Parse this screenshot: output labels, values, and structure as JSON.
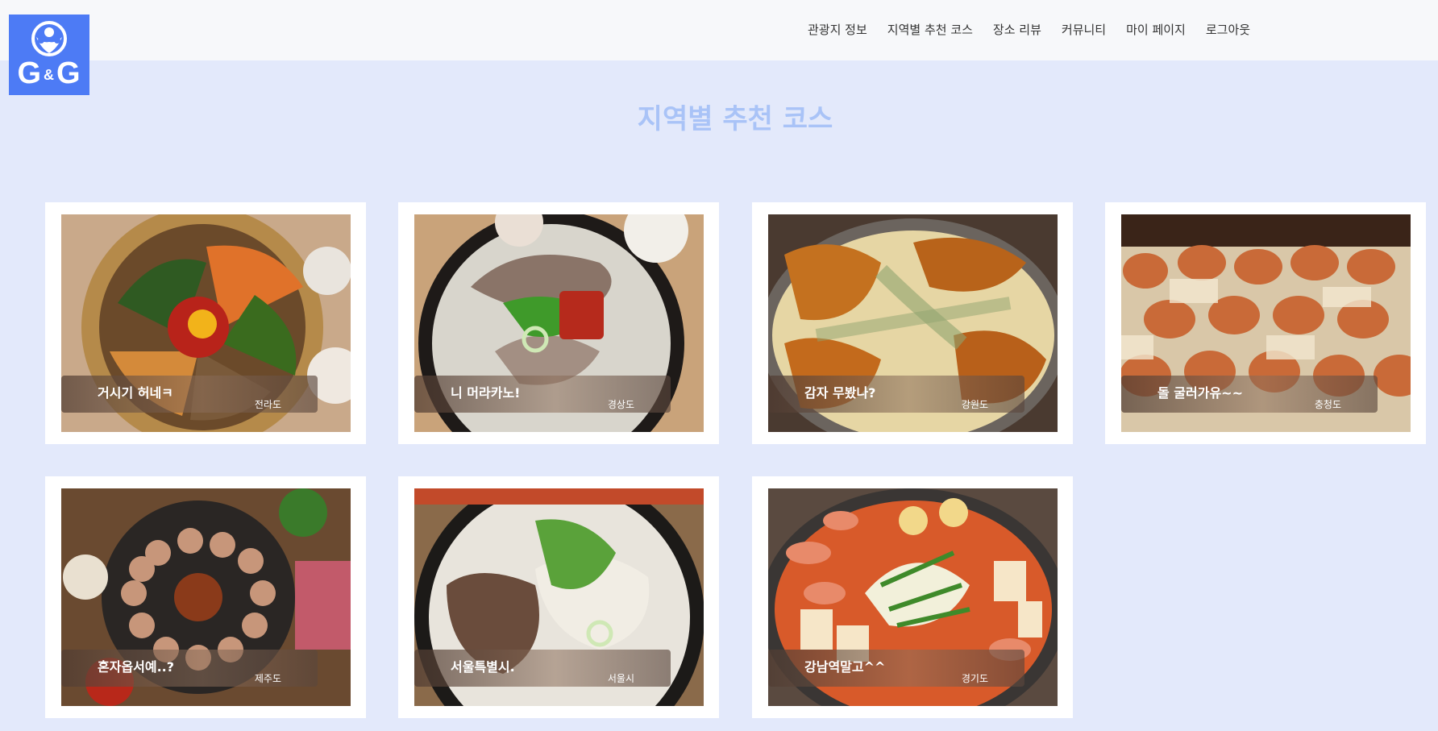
{
  "brand": {
    "logo_text_left": "G",
    "logo_text_amp": "&",
    "logo_text_right": "G"
  },
  "nav": [
    {
      "label": "관광지 정보"
    },
    {
      "label": "지역별 추천 코스"
    },
    {
      "label": "장소 리뷰"
    },
    {
      "label": "커뮤니티"
    },
    {
      "label": "마이 페이지"
    },
    {
      "label": "로그아웃"
    }
  ],
  "page": {
    "title": "지역별 추천 코스"
  },
  "cards": [
    {
      "title": "거시기 허네ㅋ",
      "region": "전라도",
      "image": "bibimbap"
    },
    {
      "title": "니 머라카노!",
      "region": "경상도",
      "image": "pork-soup"
    },
    {
      "title": "감자 무봤나?",
      "region": "강원도",
      "image": "dakgalbi"
    },
    {
      "title": "돌 굴러가유~~",
      "region": "충청도",
      "image": "bread"
    },
    {
      "title": "혼자옵서예..?",
      "region": "제주도",
      "image": "black-pork"
    },
    {
      "title": "서울특별시.",
      "region": "서울시",
      "image": "gomtang"
    },
    {
      "title": "강남역말고^^",
      "region": "경기도",
      "image": "budae-jjigae"
    }
  ],
  "colors": {
    "accent": "#4d7bf5",
    "background": "#e3e9fb",
    "title": "#a9c3f7"
  }
}
